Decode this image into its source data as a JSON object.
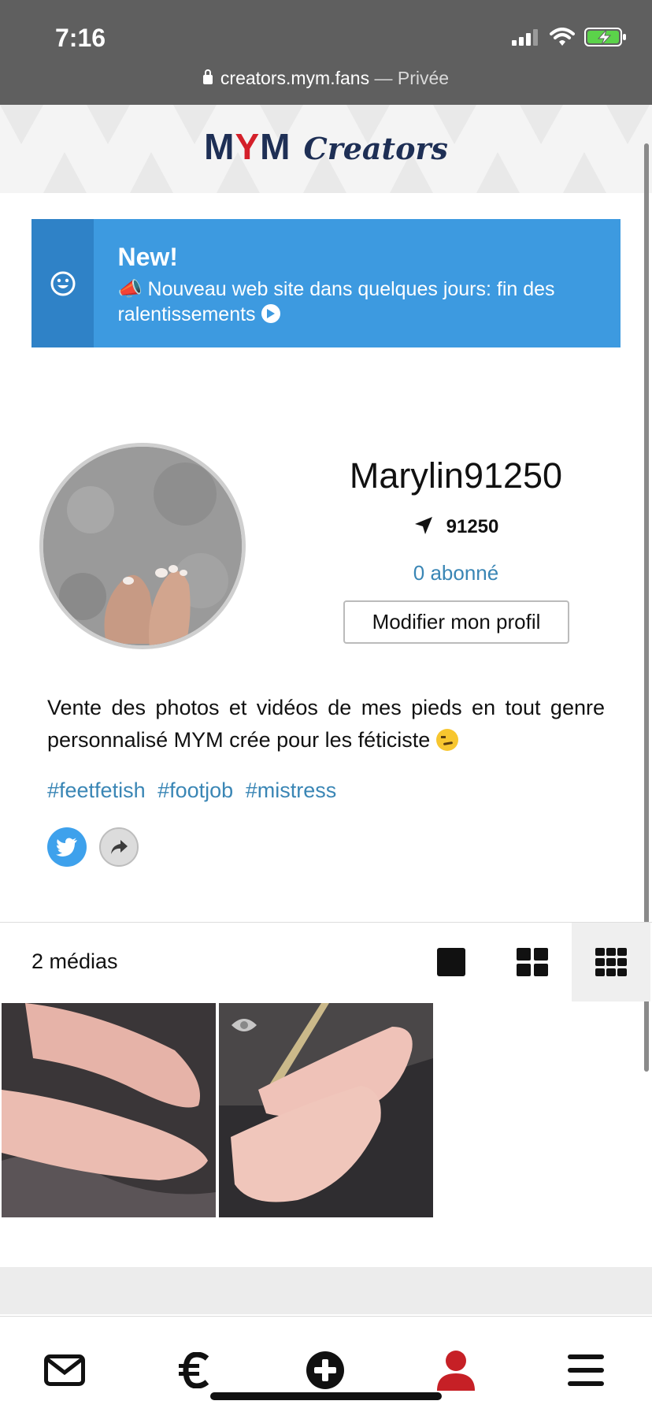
{
  "status_bar": {
    "time": "7:16"
  },
  "browser": {
    "url": "creators.mym.fans",
    "separator": "—",
    "mode": "Privée"
  },
  "brand": {
    "name_left": "M",
    "name_mid": "Y",
    "name_right": "M",
    "suffix": "Creators",
    "navy": "#1e2f55",
    "red": "#d4202a"
  },
  "notice": {
    "title": "New!",
    "body": "📣 Nouveau web site dans quelques jours: fin des ralentissements",
    "icon": "smile-icon",
    "color": "#3d9ae0"
  },
  "profile": {
    "username": "Marylin91250",
    "location": "91250",
    "subscribers": "0 abonné",
    "edit_button": "Modifier mon profil",
    "bio": "Vente des photos et vidéos de mes pieds en tout genre personnalisé MYM crée pour les féticiste",
    "tags": [
      "#feetfetish",
      "#footjob",
      "#mistress"
    ],
    "social": [
      "twitter-icon",
      "share-icon"
    ]
  },
  "media": {
    "count_label": "2 médias",
    "views": [
      "single-view-icon",
      "grid-2-icon",
      "grid-3-icon"
    ],
    "active_view": "grid-3-icon"
  },
  "tabbar": {
    "items": [
      "mail-icon",
      "euro-icon",
      "plus-circle-icon",
      "profile-icon",
      "menu-icon"
    ],
    "active": "profile-icon",
    "active_color": "#c62026"
  }
}
